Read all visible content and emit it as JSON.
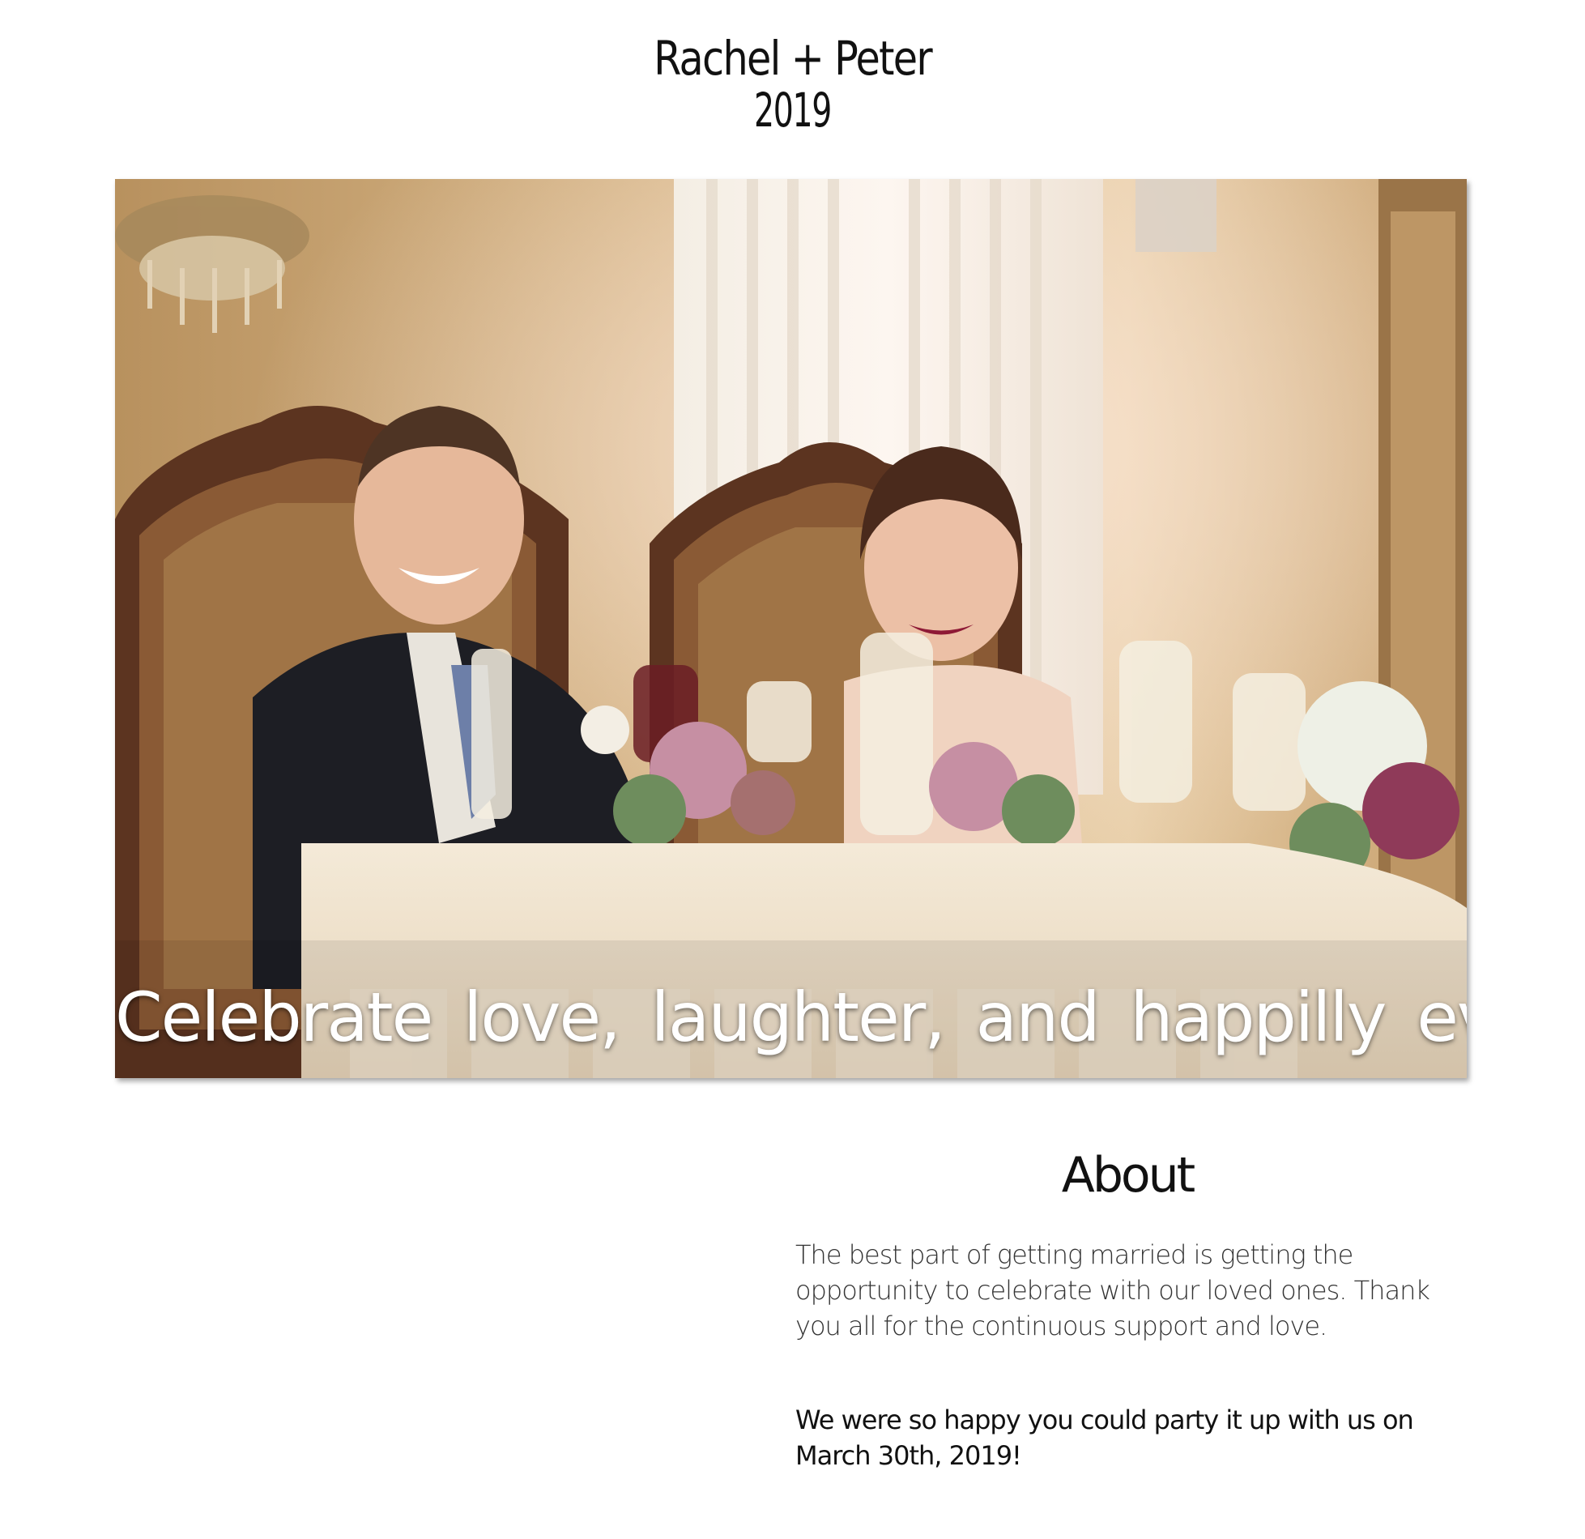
{
  "header": {
    "title": "Rachel + Peter",
    "year": "2019"
  },
  "hero": {
    "caption": "Celebrate love, laughter, and happilly ever after!"
  },
  "about": {
    "heading": "About",
    "paragraph": "The best part of getting married is getting the opportunity to celebrate with our loved ones. Thank you all for the continuous support and love.",
    "highlight": "We were so happy you could party it up with us on March 30th, 2019!"
  },
  "colors": {
    "background": "#ffffff",
    "text": "#111111",
    "body_text": "#333333",
    "caption": "#ffffff"
  }
}
